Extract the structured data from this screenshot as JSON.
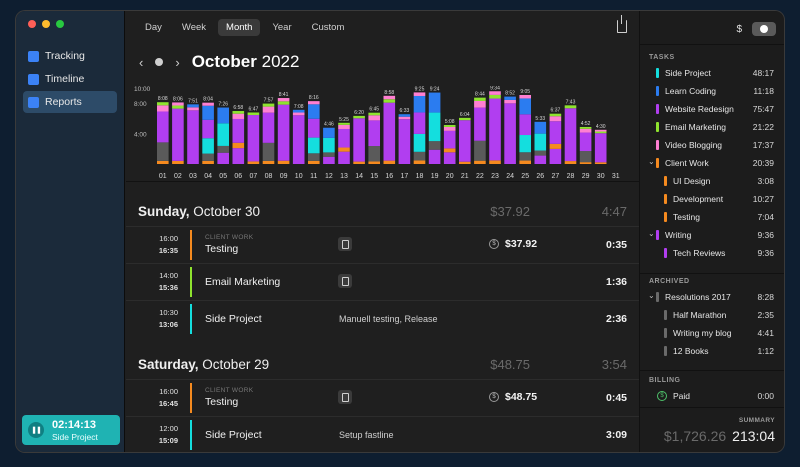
{
  "sidebar": {
    "items": [
      {
        "label": "Tracking",
        "icon": "tracking-icon",
        "color": "#3b82f6"
      },
      {
        "label": "Timeline",
        "icon": "timeline-icon",
        "color": "#3b82f6"
      },
      {
        "label": "Reports",
        "icon": "reports-icon",
        "color": "#3b82f6",
        "active": true
      }
    ],
    "timer": {
      "time": "02:14:13",
      "project": "Side Project"
    }
  },
  "toolbar": {
    "tabs": [
      {
        "label": "Day"
      },
      {
        "label": "Week"
      },
      {
        "label": "Month",
        "active": true
      },
      {
        "label": "Year"
      },
      {
        "label": "Custom"
      }
    ]
  },
  "header": {
    "month": "October",
    "year": "2022"
  },
  "chart_data": {
    "type": "bar",
    "y_ticks": [
      "10:00",
      "8:00",
      "4:00"
    ],
    "ylim": [
      0,
      10
    ],
    "categories": [
      "01",
      "02",
      "03",
      "04",
      "05",
      "06",
      "07",
      "08",
      "09",
      "10",
      "11",
      "12",
      "13",
      "14",
      "15",
      "16",
      "17",
      "18",
      "19",
      "20",
      "21",
      "22",
      "23",
      "24",
      "25",
      "26",
      "27",
      "28",
      "29",
      "30",
      "31"
    ],
    "labels": [
      "8:08",
      "8:06",
      "7:51",
      "8:04",
      "7:26",
      "6:58",
      "6:47",
      "7:57",
      "8:41",
      "7:08",
      "8:16",
      "4:46",
      "5:25",
      "6:20",
      "6:45",
      "8:58",
      "6:33",
      "9:25",
      "9:24",
      "5:08",
      "6:04",
      "8:44",
      "9:34",
      "8:52",
      "9:05",
      "5:33",
      "6:37",
      "7:43",
      "4:52",
      "4:30",
      ""
    ],
    "totals": [
      8.13,
      8.1,
      7.85,
      8.07,
      7.43,
      6.97,
      6.78,
      7.95,
      8.68,
      7.13,
      8.27,
      4.77,
      5.42,
      6.33,
      6.75,
      8.97,
      6.55,
      9.42,
      9.4,
      5.13,
      6.07,
      8.73,
      9.57,
      8.87,
      9.08,
      5.55,
      6.62,
      7.72,
      4.87,
      4.5,
      0
    ],
    "colors": {
      "purple": "#b13ef0",
      "cyan": "#14dede",
      "pink": "#ff7fd2",
      "orange": "#f58a1f",
      "gray": "#5a5a5a",
      "blue": "#2b7cf0",
      "lime": "#8ee32e"
    }
  },
  "days": [
    {
      "name": "Sunday,",
      "date": "October 30",
      "amount": "$37.92",
      "duration": "4:47",
      "entries": [
        {
          "start": "16:00",
          "end": "16:35",
          "category": "CLIENT WORK",
          "name": "Testing",
          "note_icon": true,
          "desc": "",
          "amount": "$37.92",
          "duration": "0:35",
          "color": "#f58a1f"
        },
        {
          "start": "14:00",
          "end": "15:36",
          "category": "",
          "name": "Email Marketing",
          "note_icon": true,
          "desc": "",
          "amount": "",
          "duration": "1:36",
          "color": "#8ee32e"
        },
        {
          "start": "10:30",
          "end": "13:06",
          "category": "",
          "name": "Side Project",
          "note_icon": false,
          "desc": "Manuell testing, Release",
          "amount": "",
          "duration": "2:36",
          "color": "#14dede"
        }
      ]
    },
    {
      "name": "Saturday,",
      "date": "October 29",
      "amount": "$48.75",
      "duration": "3:54",
      "entries": [
        {
          "start": "16:00",
          "end": "16:45",
          "category": "CLIENT WORK",
          "name": "Testing",
          "note_icon": true,
          "desc": "",
          "amount": "$48.75",
          "duration": "0:45",
          "color": "#f58a1f"
        },
        {
          "start": "12:00",
          "end": "15:09",
          "category": "",
          "name": "Side Project",
          "note_icon": false,
          "desc": "Setup fastline",
          "amount": "",
          "duration": "3:09",
          "color": "#14dede"
        }
      ]
    }
  ],
  "right": {
    "currency": "$",
    "tasks_title": "TASKS",
    "tasks": [
      {
        "label": "Side Project",
        "value": "48:17",
        "color": "#14dede",
        "indent": 0
      },
      {
        "label": "Learn Coding",
        "value": "11:18",
        "color": "#2b7cf0",
        "indent": 0
      },
      {
        "label": "Website Redesign",
        "value": "75:47",
        "color": "#b13ef0",
        "indent": 0
      },
      {
        "label": "Email Marketing",
        "value": "21:22",
        "color": "#8ee32e",
        "indent": 0
      },
      {
        "label": "Video Blogging",
        "value": "17:37",
        "color": "#ff7fd2",
        "indent": 0
      },
      {
        "label": "Client Work",
        "value": "20:39",
        "color": "#f58a1f",
        "indent": 0,
        "caret": "⌄"
      },
      {
        "label": "UI Design",
        "value": "3:08",
        "color": "#f58a1f",
        "indent": 1
      },
      {
        "label": "Development",
        "value": "10:27",
        "color": "#f58a1f",
        "indent": 1
      },
      {
        "label": "Testing",
        "value": "7:04",
        "color": "#f58a1f",
        "indent": 1
      },
      {
        "label": "Writing",
        "value": "9:36",
        "color": "#b13ef0",
        "indent": 0,
        "caret": "⌄"
      },
      {
        "label": "Tech Reviews",
        "value": "9:36",
        "color": "#b13ef0",
        "indent": 1
      }
    ],
    "archived_title": "ARCHIVED",
    "archived": [
      {
        "label": "Resolutions 2017",
        "value": "8:28",
        "color": "#6a6a6a",
        "indent": 0,
        "caret": "⌄"
      },
      {
        "label": "Half Marathon",
        "value": "2:35",
        "color": "#6a6a6a",
        "indent": 1
      },
      {
        "label": "Writing my blog",
        "value": "4:41",
        "color": "#6a6a6a",
        "indent": 1
      },
      {
        "label": "12 Books",
        "value": "1:12",
        "color": "#6a6a6a",
        "indent": 1
      }
    ],
    "billing_title": "BILLING",
    "billing": {
      "label": "Paid",
      "value": "0:00"
    },
    "summary_title": "SUMMARY",
    "summary_amount": "$1,726.26",
    "summary_duration": "213:04"
  }
}
